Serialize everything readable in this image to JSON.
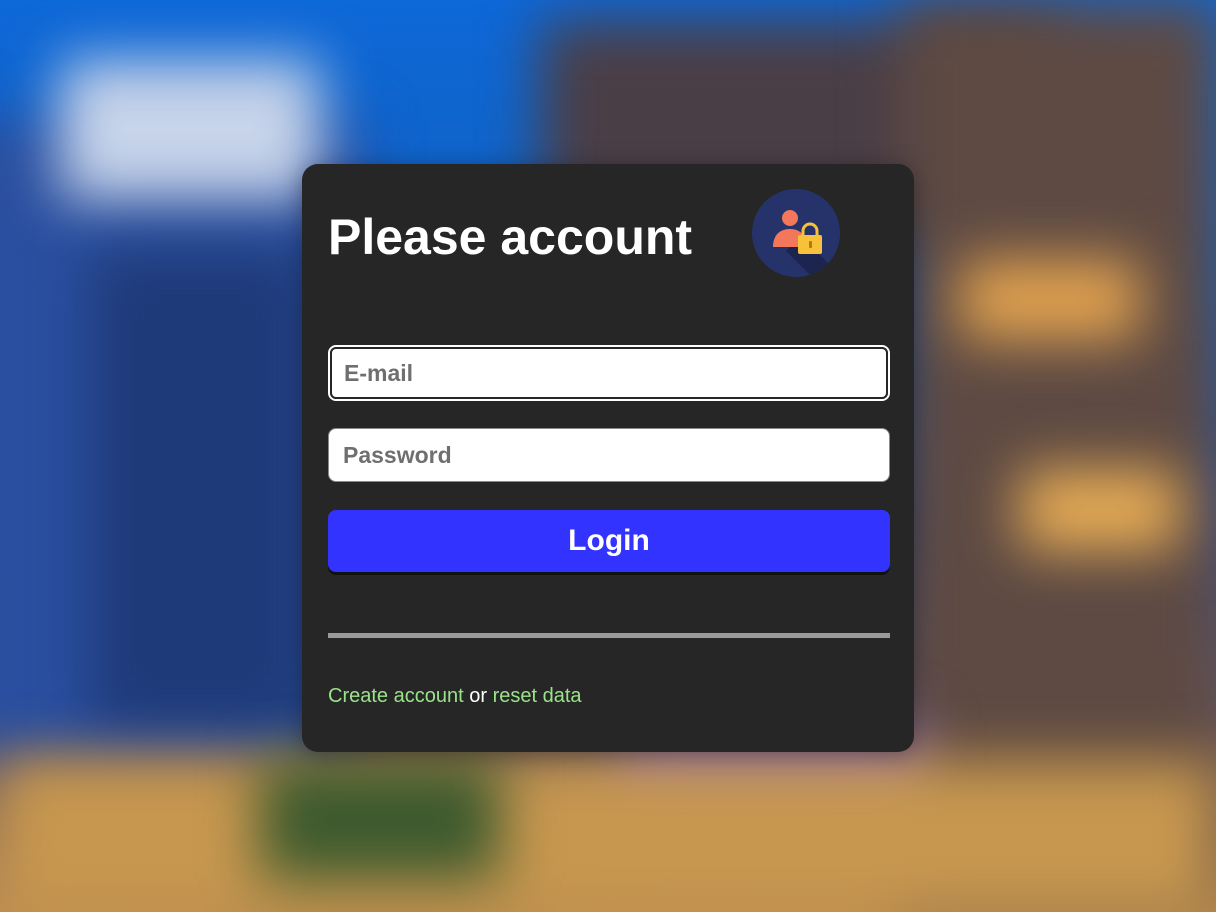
{
  "login": {
    "title": "Please account",
    "email_placeholder": "E-mail",
    "password_placeholder": "Password",
    "login_label": "Login",
    "create_account_label": "Create account",
    "separator_text": "or",
    "reset_data_label": "reset data",
    "avatar_icon": "user-lock-icon"
  },
  "colors": {
    "card_bg": "#262626",
    "button_bg": "#3333ff",
    "link": "#9be38a",
    "avatar_bg": "#26336b"
  }
}
